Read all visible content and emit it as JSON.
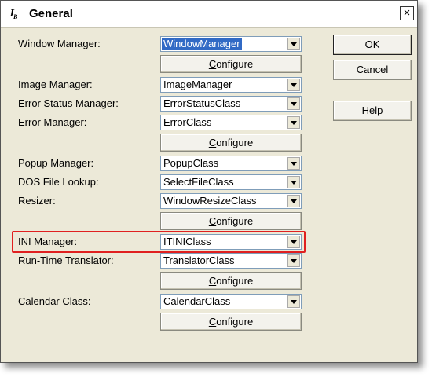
{
  "window": {
    "title": "General",
    "close_label": "×",
    "icon_text": "J",
    "icon_sub": "B"
  },
  "fields": [
    {
      "label": "Window Manager:",
      "value": "WindowManager"
    },
    {
      "label": "Image Manager:",
      "value": "ImageManager"
    },
    {
      "label": "Error Status Manager:",
      "value": "ErrorStatusClass"
    },
    {
      "label": "Error Manager:",
      "value": "ErrorClass"
    },
    {
      "label": "Popup Manager:",
      "value": "PopupClass"
    },
    {
      "label": "DOS File Lookup:",
      "value": "SelectFileClass"
    },
    {
      "label": "Resizer:",
      "value": "WindowResizeClass"
    },
    {
      "label": "INI Manager:",
      "value": "ITINIClass"
    },
    {
      "label": "Run-Time Translator:",
      "value": "TranslatorClass"
    },
    {
      "label": "Calendar Class:",
      "value": "CalendarClass"
    }
  ],
  "configure_label": {
    "first": "C",
    "rest": "onfigure"
  },
  "buttons": {
    "ok": {
      "first": "O",
      "rest": "K"
    },
    "cancel": "Cancel",
    "help": {
      "first": "H",
      "rest": "elp"
    }
  }
}
